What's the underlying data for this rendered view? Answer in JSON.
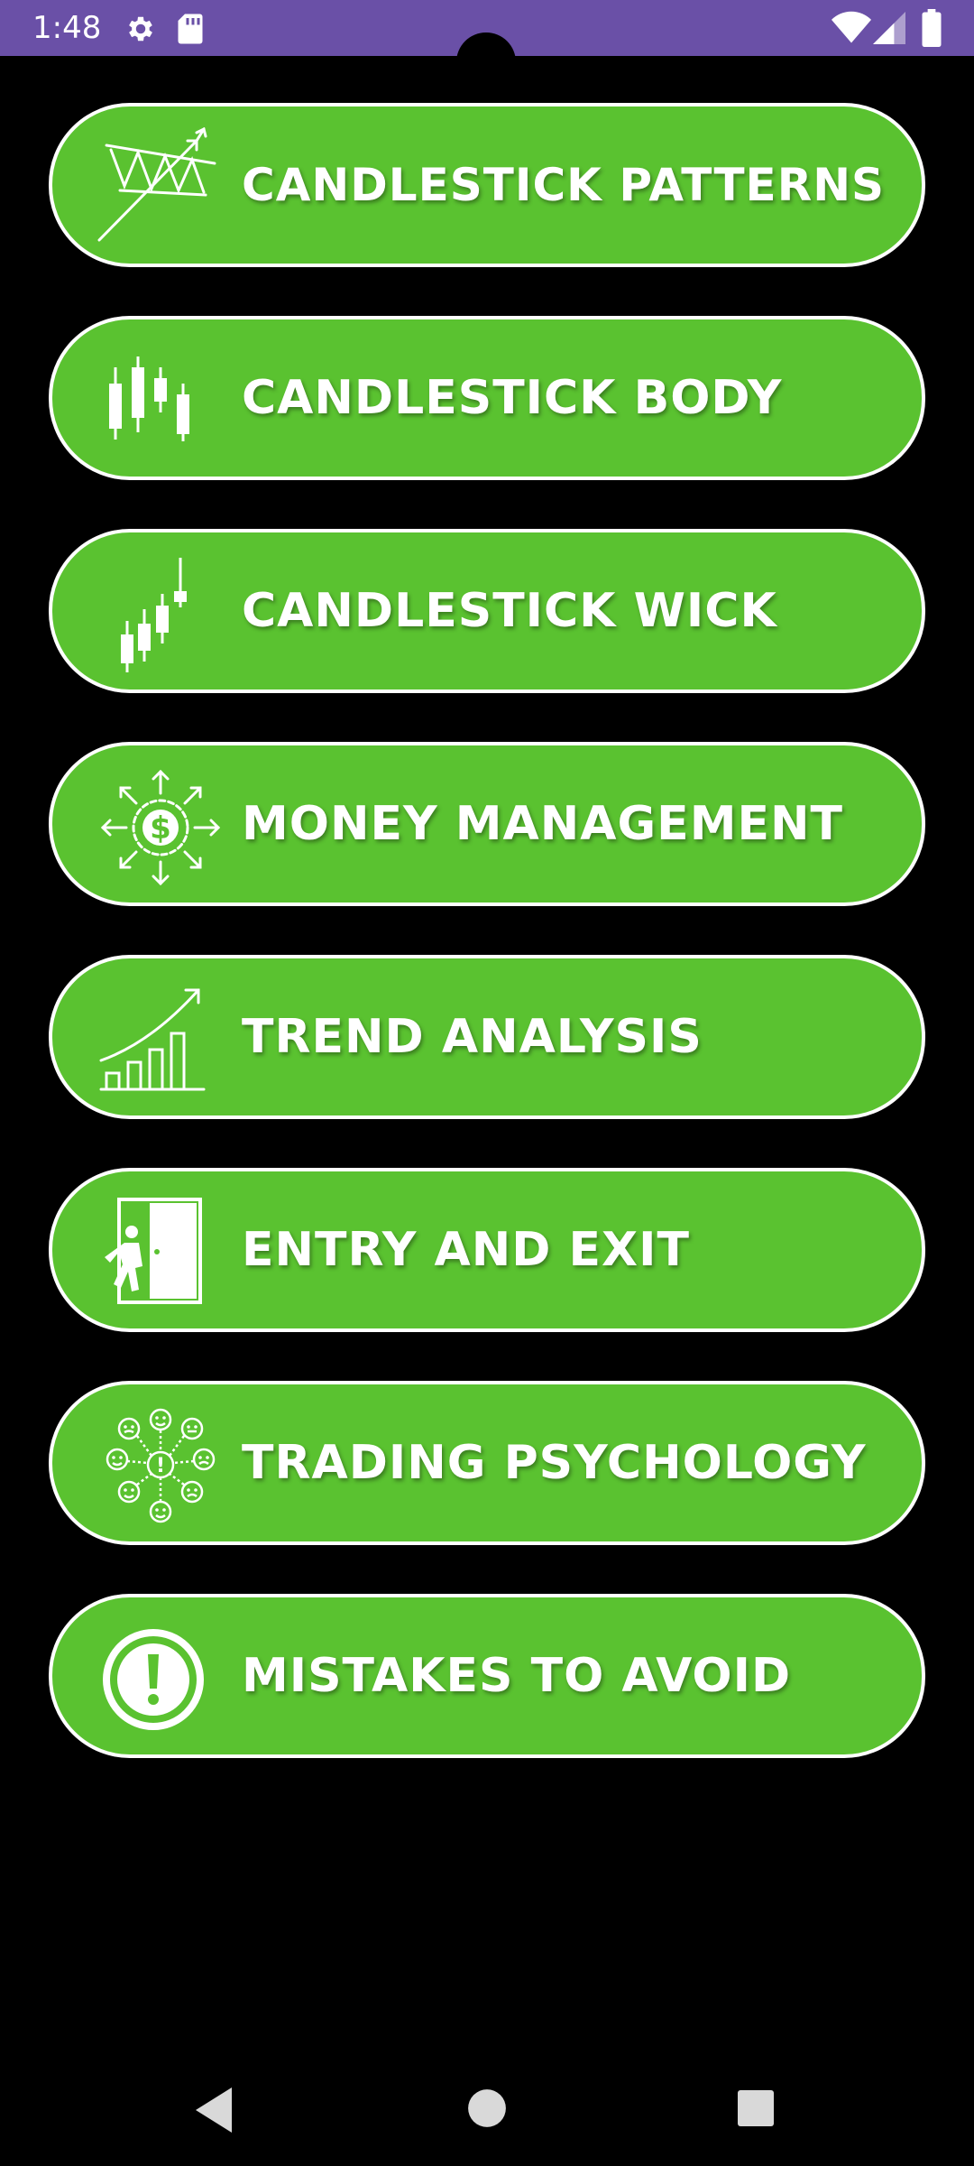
{
  "status_bar": {
    "time": "1:48",
    "background": "#6a50a7",
    "icons": [
      "settings-gear-icon",
      "sd-card-icon",
      "wifi-icon",
      "cell-signal-icon",
      "battery-icon"
    ]
  },
  "menu": {
    "button_color": "#5ac230",
    "border_color": "#ffffff",
    "items": [
      {
        "label": "CANDLESTICK PATTERNS",
        "icon": "wedge-pattern-icon"
      },
      {
        "label": "CANDLESTICK BODY",
        "icon": "candlestick-body-icon"
      },
      {
        "label": "CANDLESTICK WICK",
        "icon": "candlestick-wick-icon"
      },
      {
        "label": "MONEY MANAGEMENT",
        "icon": "money-management-icon"
      },
      {
        "label": "TREND ANALYSIS",
        "icon": "trend-chart-icon"
      },
      {
        "label": "ENTRY AND EXIT",
        "icon": "door-exit-icon"
      },
      {
        "label": "TRADING PSYCHOLOGY",
        "icon": "emotions-psychology-icon"
      },
      {
        "label": "MISTAKES TO AVOID",
        "icon": "exclamation-warning-icon"
      }
    ]
  },
  "nav_bar": {
    "buttons": [
      "back-icon",
      "home-icon",
      "recents-icon"
    ]
  }
}
